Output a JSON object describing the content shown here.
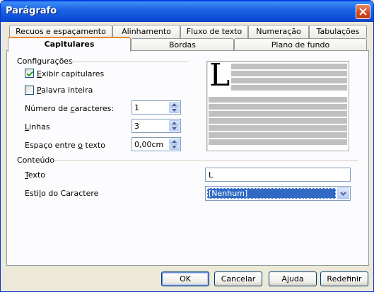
{
  "window": {
    "title": "Parágrafo"
  },
  "tabs_row1": [
    {
      "label": "Recuos e espaçamento"
    },
    {
      "label": "Alinhamento"
    },
    {
      "label": "Fluxo de texto"
    },
    {
      "label": "Numeração"
    },
    {
      "label": "Tabulações"
    }
  ],
  "tabs_row2": [
    {
      "label": "Capitulares",
      "active": true
    },
    {
      "label": "Bordas"
    },
    {
      "label": "Plano de fundo"
    }
  ],
  "settings": {
    "group_label": "Configurações",
    "show_dropcaps": {
      "label_u": "E",
      "label_rest": "xibir capitulares",
      "checked": true
    },
    "whole_word": {
      "label_u": "P",
      "label_rest": "alavra inteira",
      "checked": false
    },
    "num_chars": {
      "label_pre": "Número de ",
      "label_u": "c",
      "label_post": "aracteres:",
      "value": "1"
    },
    "lines": {
      "label_u": "L",
      "label_rest": "inhas",
      "value": "3"
    },
    "spacing": {
      "label_pre": "Espaço entre ",
      "label_u": "o",
      "label_post": " texto",
      "value": "0,00cm"
    }
  },
  "preview": {
    "letter": "L"
  },
  "contents": {
    "group_label": "Conteúdo",
    "text": {
      "label_u": "T",
      "label_rest": "exto",
      "value": "L"
    },
    "char_style": {
      "label_pre": "Esti",
      "label_u": "l",
      "label_post": "o do Caractere",
      "value": "[Nenhum]"
    }
  },
  "buttons": {
    "ok": "OK",
    "cancel": "Cancelar",
    "help_pre": "A",
    "help_u": "j",
    "help_post": "uda",
    "reset": "Redefinir"
  }
}
